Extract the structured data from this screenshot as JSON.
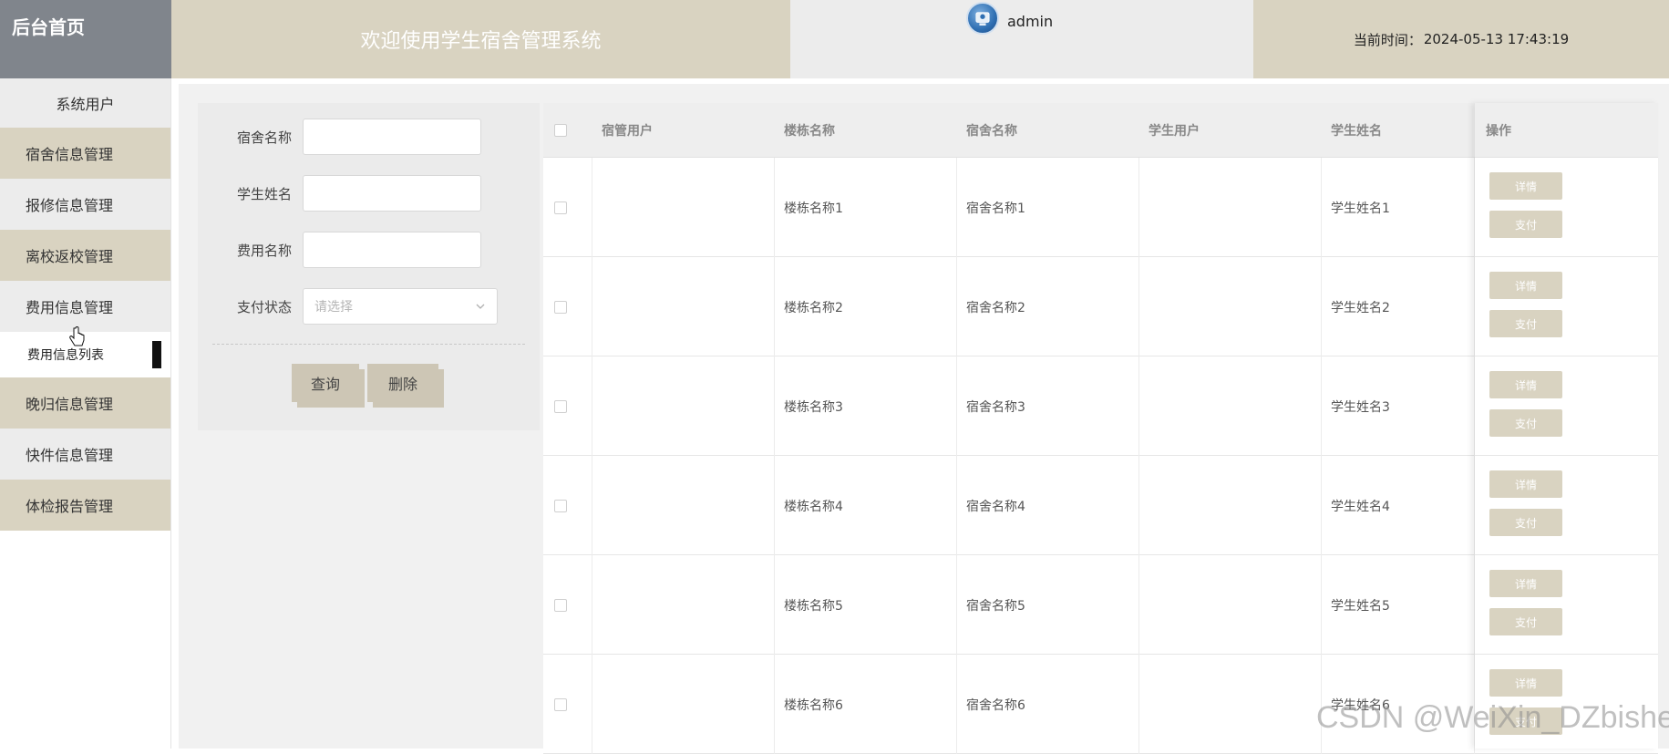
{
  "header": {
    "brand": "后台首页",
    "welcome": "欢迎使用学生宿舍管理系统",
    "username": "admin",
    "time_label": "当前时间：",
    "time_value": "2024-05-13 17:43:19"
  },
  "sidebar": {
    "items": [
      {
        "label": "系统用户"
      },
      {
        "label": "宿舍信息管理"
      },
      {
        "label": "报修信息管理"
      },
      {
        "label": "离校返校管理"
      },
      {
        "label": "费用信息管理"
      },
      {
        "label": "费用信息列表"
      },
      {
        "label": "晚归信息管理"
      },
      {
        "label": "快件信息管理"
      },
      {
        "label": "体检报告管理"
      }
    ]
  },
  "filter": {
    "dorm_name_label": "宿舍名称",
    "dorm_name_value": "",
    "student_name_label": "学生姓名",
    "student_name_value": "",
    "fee_name_label": "费用名称",
    "fee_name_value": "",
    "pay_status_label": "支付状态",
    "pay_status_placeholder": "请选择",
    "query_button": "查询",
    "delete_button": "删除"
  },
  "table": {
    "columns": [
      "宿管用户",
      "楼栋名称",
      "宿舍名称",
      "学生用户",
      "学生姓名",
      "操作"
    ],
    "detail_label": "详情",
    "pay_label": "支付",
    "rows": [
      {
        "manager": "",
        "building": "楼栋名称1",
        "dorm": "宿舍名称1",
        "student_user": "",
        "student_name": "学生姓名1"
      },
      {
        "manager": "",
        "building": "楼栋名称2",
        "dorm": "宿舍名称2",
        "student_user": "",
        "student_name": "学生姓名2"
      },
      {
        "manager": "",
        "building": "楼栋名称3",
        "dorm": "宿舍名称3",
        "student_user": "",
        "student_name": "学生姓名3"
      },
      {
        "manager": "",
        "building": "楼栋名称4",
        "dorm": "宿舍名称4",
        "student_user": "",
        "student_name": "学生姓名4"
      },
      {
        "manager": "",
        "building": "楼栋名称5",
        "dorm": "宿舍名称5",
        "student_user": "",
        "student_name": "学生姓名5"
      },
      {
        "manager": "",
        "building": "楼栋名称6",
        "dorm": "宿舍名称6",
        "student_user": "",
        "student_name": "学生姓名6"
      }
    ]
  },
  "watermark": "CSDN @WeiXin_DZbishe",
  "icons": {
    "avatar": "user-avatar-icon",
    "select": "chevron-down-icon",
    "cursor": "hand-pointer-icon"
  },
  "colors": {
    "tan": "#d9d3c1",
    "gray_brand": "#80858c",
    "light": "#ececec"
  }
}
